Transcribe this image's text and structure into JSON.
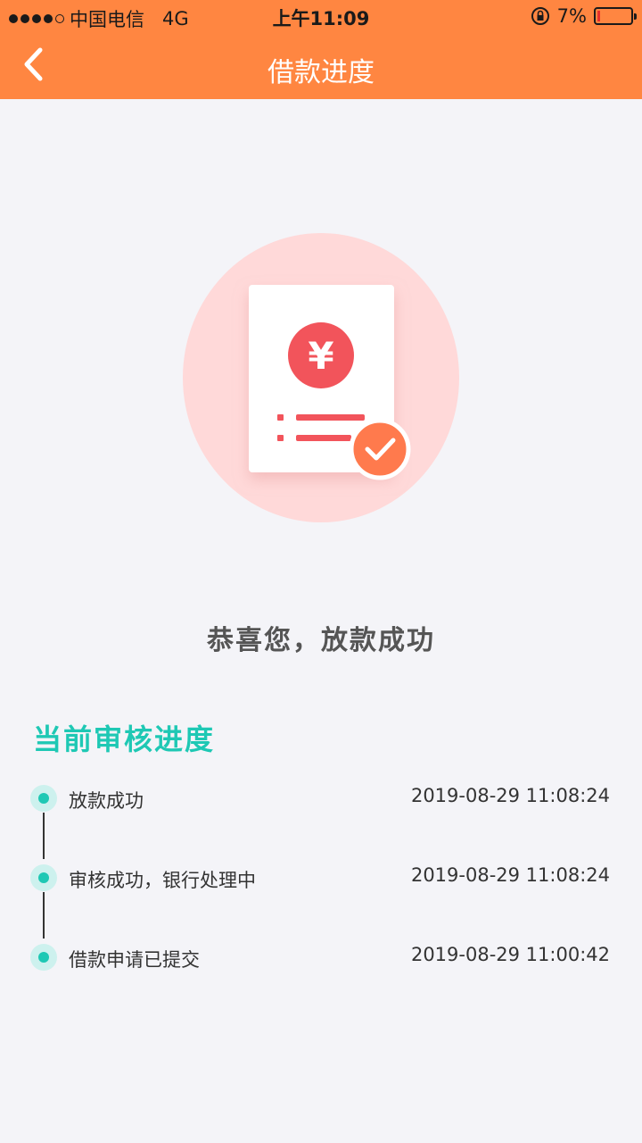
{
  "status_bar": {
    "carrier": "中国电信",
    "network": "4G",
    "time": "上午11:09",
    "battery": "7%",
    "battery_level": 0.07
  },
  "nav": {
    "back_icon": "chevron-left-icon",
    "title": "借款进度"
  },
  "hero": {
    "illustration": "loan-document-success-icon",
    "currency_symbol": "¥"
  },
  "success_message": "恭喜您，放款成功",
  "progress": {
    "title": "当前审核进度",
    "items": [
      {
        "label": "放款成功",
        "time": "2019-08-29 11:08:24"
      },
      {
        "label": "审核成功，银行处理中",
        "time": "2019-08-29 11:08:24"
      },
      {
        "label": "借款申请已提交",
        "time": "2019-08-29 11:00:42"
      }
    ]
  },
  "colors": {
    "header": "#ff8641",
    "accent": "#1ec8b4",
    "hero_circle": "#ffd9d9",
    "coin": "#f2545b",
    "check": "#ff7a4d"
  }
}
